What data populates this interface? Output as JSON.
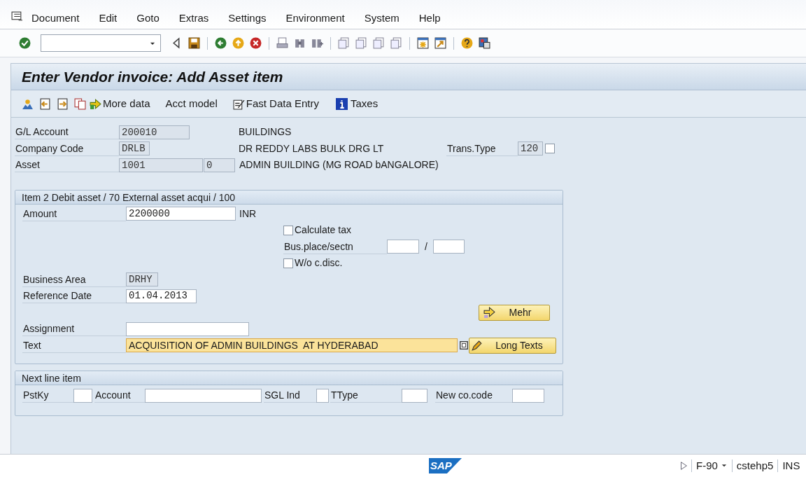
{
  "menu_bar": {
    "items": [
      "Document",
      "Edit",
      "Goto",
      "Extras",
      "Settings",
      "Environment",
      "System",
      "Help"
    ]
  },
  "screen_title": "Enter Vendor invoice: Add Asset item",
  "app_toolbar": {
    "buttons": [
      {
        "kind": "more",
        "label": "More data"
      },
      {
        "kind": "plain",
        "label": "Acct model"
      },
      {
        "kind": "fast",
        "label": "Fast Data Entry"
      },
      {
        "kind": "info",
        "label": "Taxes"
      }
    ]
  },
  "header": {
    "gl_account": {
      "label": "G/L Account",
      "value": "200010",
      "description": "BUILDINGS"
    },
    "company_code": {
      "label": "Company Code",
      "value": "DRLB",
      "description": "DR REDDY LABS BULK DRG LT"
    },
    "trans_type": {
      "label": "Trans.Type",
      "value": "120",
      "checked": false
    },
    "asset": {
      "label": "Asset",
      "value": "1001",
      "subnumber": "0",
      "description": "ADMIN BUILDING (MG ROAD bANGALORE)"
    }
  },
  "item_group": {
    "title": "Item 2 Debit asset / 70 External asset acqui / 100",
    "amount": {
      "label": "Amount",
      "value": "2200000",
      "currency": "INR"
    },
    "calculate_tax": {
      "label": "Calculate tax",
      "checked": false
    },
    "bus_place": {
      "label": "Bus.place/sectn",
      "separator": "/"
    },
    "wo_cdisc": {
      "label": "W/o c.disc.",
      "checked": false
    },
    "business_area": {
      "label": "Business Area",
      "value": "DRHY"
    },
    "reference_date": {
      "label": "Reference Date",
      "value": "01.04.2013"
    },
    "mehr_button": "Mehr",
    "assignment": {
      "label": "Assignment"
    },
    "text": {
      "label": "Text",
      "value": "ACQUISITION OF ADMIN BUILDINGS  AT HYDERABAD"
    },
    "long_texts_button": "Long Texts"
  },
  "next_line_item": {
    "title": "Next line item",
    "fields": [
      {
        "label": "PstKy"
      },
      {
        "label": "Account"
      },
      {
        "label": "SGL Ind"
      },
      {
        "label": "TType"
      },
      {
        "label": "New co.code"
      }
    ]
  },
  "status_bar": {
    "logo_text": "SAP",
    "transaction": "F-90",
    "server": "cstehp5",
    "mode": "INS"
  }
}
